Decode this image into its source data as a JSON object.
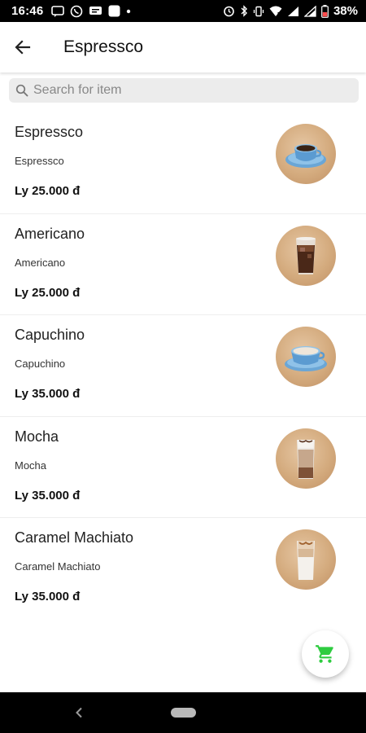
{
  "status_bar": {
    "time": "16:46",
    "battery_percent": "38%"
  },
  "app_bar": {
    "title": "Espressco"
  },
  "search": {
    "placeholder": "Search for item",
    "value": ""
  },
  "items": [
    {
      "name": "Espressco",
      "description": "Espressco",
      "price": "Ly 25.000 đ",
      "image": "espresso-cup"
    },
    {
      "name": "Americano",
      "description": "Americano",
      "price": "Ly 25.000 đ",
      "image": "iced-glass"
    },
    {
      "name": "Capuchino",
      "description": "Capuchino",
      "price": "Ly 35.000 đ",
      "image": "cappuccino-cup"
    },
    {
      "name": "Mocha",
      "description": "Mocha",
      "price": "Ly 35.000 đ",
      "image": "mocha-glass"
    },
    {
      "name": "Caramel Machiato",
      "description": "Caramel Machiato",
      "price": "Ly 35.000 đ",
      "image": "macchiato-glass"
    }
  ],
  "fab": {
    "icon": "cart-icon",
    "color": "#2ecc40"
  },
  "colors": {
    "accent": "#2ecc40",
    "status_bar": "#000000",
    "search_bg": "#ececec"
  }
}
